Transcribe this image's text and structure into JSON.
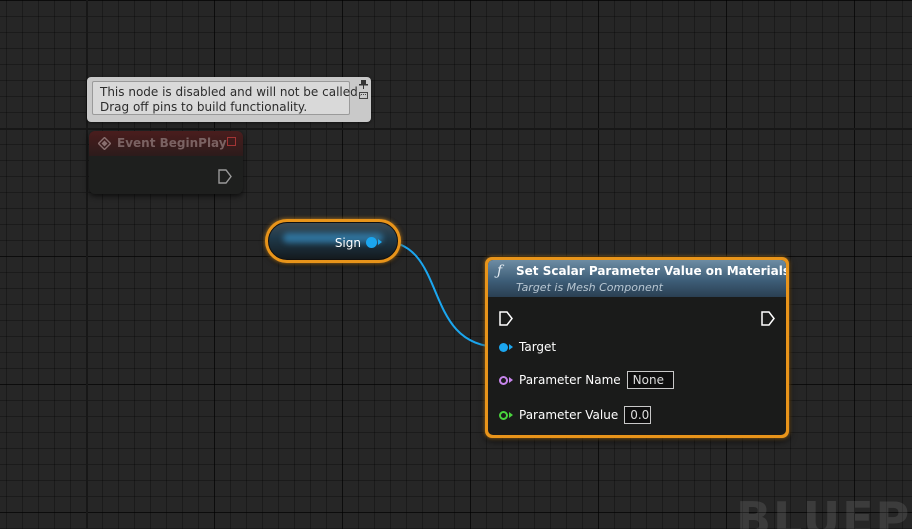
{
  "comment": {
    "line1": "This node is disabled and will not be called.",
    "line2": "Drag off pins to build functionality."
  },
  "event_node": {
    "title": "Event BeginPlay",
    "state": "disabled"
  },
  "variable_node": {
    "label": "Sign",
    "pin_color": "#1ba6ef"
  },
  "function_node": {
    "icon": "ƒ",
    "title": "Set Scalar Parameter Value on Materials",
    "subtitle": "Target is Mesh Component",
    "pins": {
      "target": {
        "label": "Target",
        "color": "#1ba6ef"
      },
      "parameter_name": {
        "label": "Parameter Name",
        "value": "None",
        "color": "#c785ec"
      },
      "parameter_value": {
        "label": "Parameter Value",
        "value": "0.0",
        "color": "#49d43d"
      }
    }
  },
  "colors": {
    "selection": "#e8941a",
    "header_function": "#3e5e78",
    "header_event_disabled": "#4a1d1d"
  },
  "watermark": "BLUEP"
}
